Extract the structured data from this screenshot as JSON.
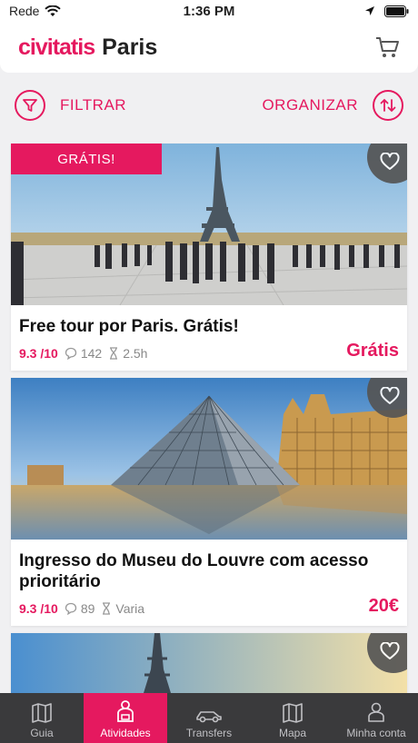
{
  "status_bar": {
    "carrier": "Rede",
    "time": "1:36 PM"
  },
  "header": {
    "brand": "civitatis",
    "city": "Paris"
  },
  "toolbar": {
    "filter_label": "FILTRAR",
    "sort_label": "ORGANIZAR"
  },
  "cards": [
    {
      "badge": "GRÁTIS!",
      "title": "Free tour por Paris. Grátis!",
      "rating": "9.3 /10",
      "reviews": "142",
      "duration": "2.5h",
      "price": "Grátis"
    },
    {
      "title": "Ingresso do Museu do Louvre com acesso prioritário",
      "rating": "9.3 /10",
      "reviews": "89",
      "duration": "Varia",
      "price": "20€"
    }
  ],
  "tabs": [
    {
      "label": "Guia",
      "icon": "book-icon"
    },
    {
      "label": "Atividades",
      "icon": "guide-person-icon",
      "active": true
    },
    {
      "label": "Transfers",
      "icon": "car-icon"
    },
    {
      "label": "Mapa",
      "icon": "map-icon"
    },
    {
      "label": "Minha conta",
      "icon": "user-icon"
    }
  ],
  "colors": {
    "accent": "#e5195f",
    "tabbar": "#3a3a3c",
    "background": "#f0f0f2"
  }
}
